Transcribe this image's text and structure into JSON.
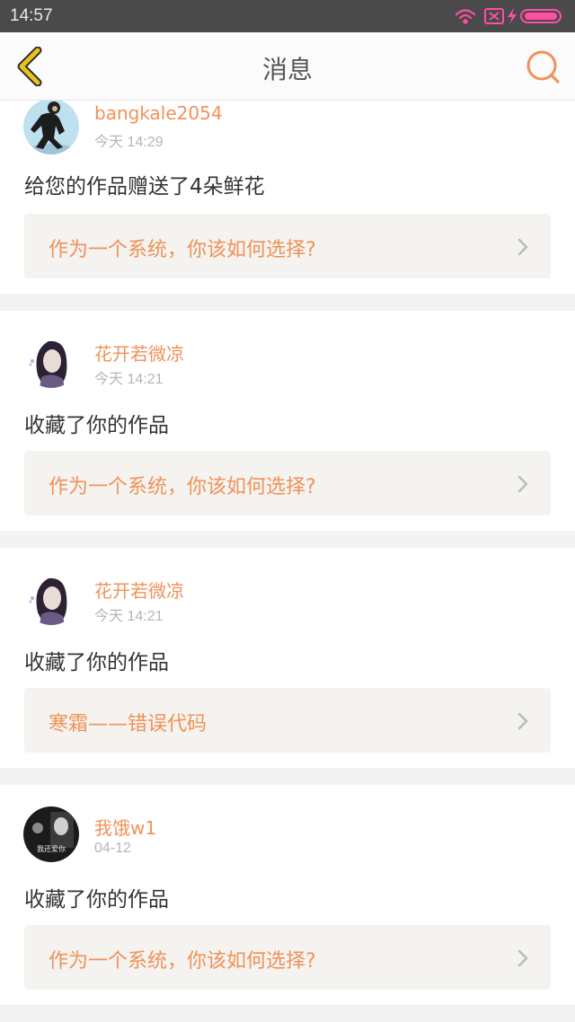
{
  "status_bar": {
    "time": "14:57"
  },
  "header": {
    "title": "消息"
  },
  "messages": [
    {
      "username": "bangkale2054",
      "time": "今天 14:29",
      "action": "给您的作品赠送了4朵鲜花",
      "work_title": "作为一个系统，你该如何选择?"
    },
    {
      "username": "花开若微凉",
      "time": "今天 14:21",
      "action": "收藏了你的作品",
      "work_title": "作为一个系统，你该如何选择?"
    },
    {
      "username": "花开若微凉",
      "time": "今天 14:21",
      "action": "收藏了你的作品",
      "work_title": "寒霜——错误代码"
    },
    {
      "username": "我饿w1",
      "time": "04-12",
      "action": "收藏了你的作品",
      "work_title": "作为一个系统，你该如何选择?",
      "avatar_text": "我还爱你"
    }
  ],
  "colors": {
    "accent": "#f0925a",
    "back_icon": "#e9c21f",
    "status_icons": "#ff4fa3"
  }
}
